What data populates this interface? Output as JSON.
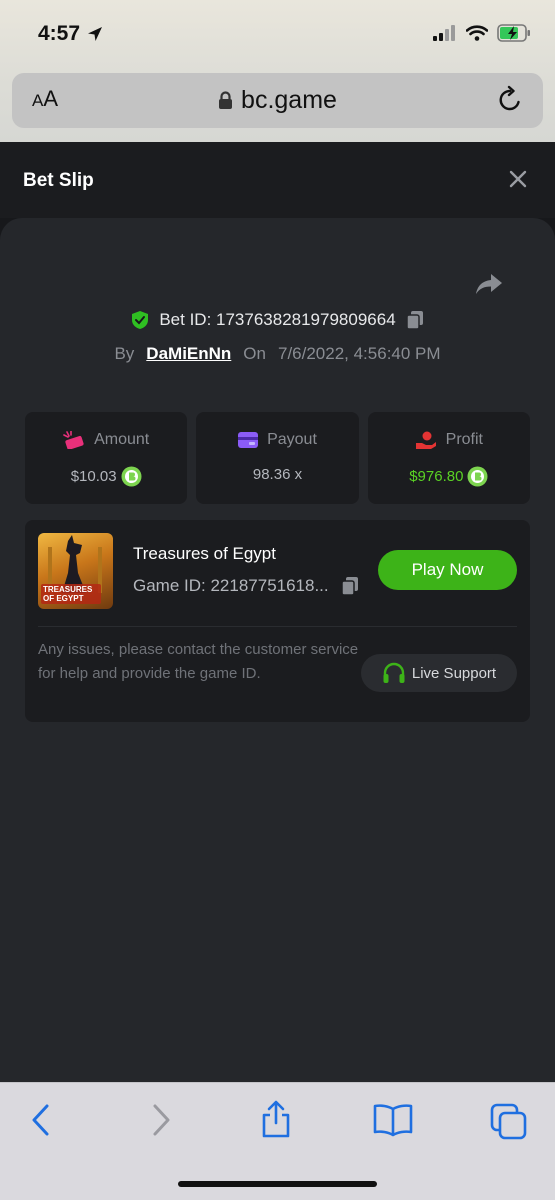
{
  "status": {
    "time": "4:57"
  },
  "browser": {
    "text_size_label": "AA",
    "url": "bc.game"
  },
  "bet_slip": {
    "title": "Bet Slip",
    "bet_id_label": "Bet ID: 1737638281979809664",
    "by_label": "By",
    "username": "DaMiEnNn",
    "on_label": "On",
    "date": "7/6/2022, 4:56:40 PM",
    "stats": {
      "amount_label": "Amount",
      "amount_value": "$10.03",
      "payout_label": "Payout",
      "payout_value": "98.36 x",
      "profit_label": "Profit",
      "profit_value": "$976.80"
    },
    "game": {
      "thumb_text": "TREASURES OF EGYPT",
      "name": "Treasures of Egypt",
      "game_id": "Game ID: 22187751618...",
      "play_label": "Play Now"
    },
    "notice": "Any issues, please contact the customer service for help and provide the game ID.",
    "live_support_label": "Live Support"
  },
  "colors": {
    "accent_green": "#3db318",
    "profit_green": "#5ad224",
    "background": "#25272b",
    "panel": "#1b1c1f"
  }
}
